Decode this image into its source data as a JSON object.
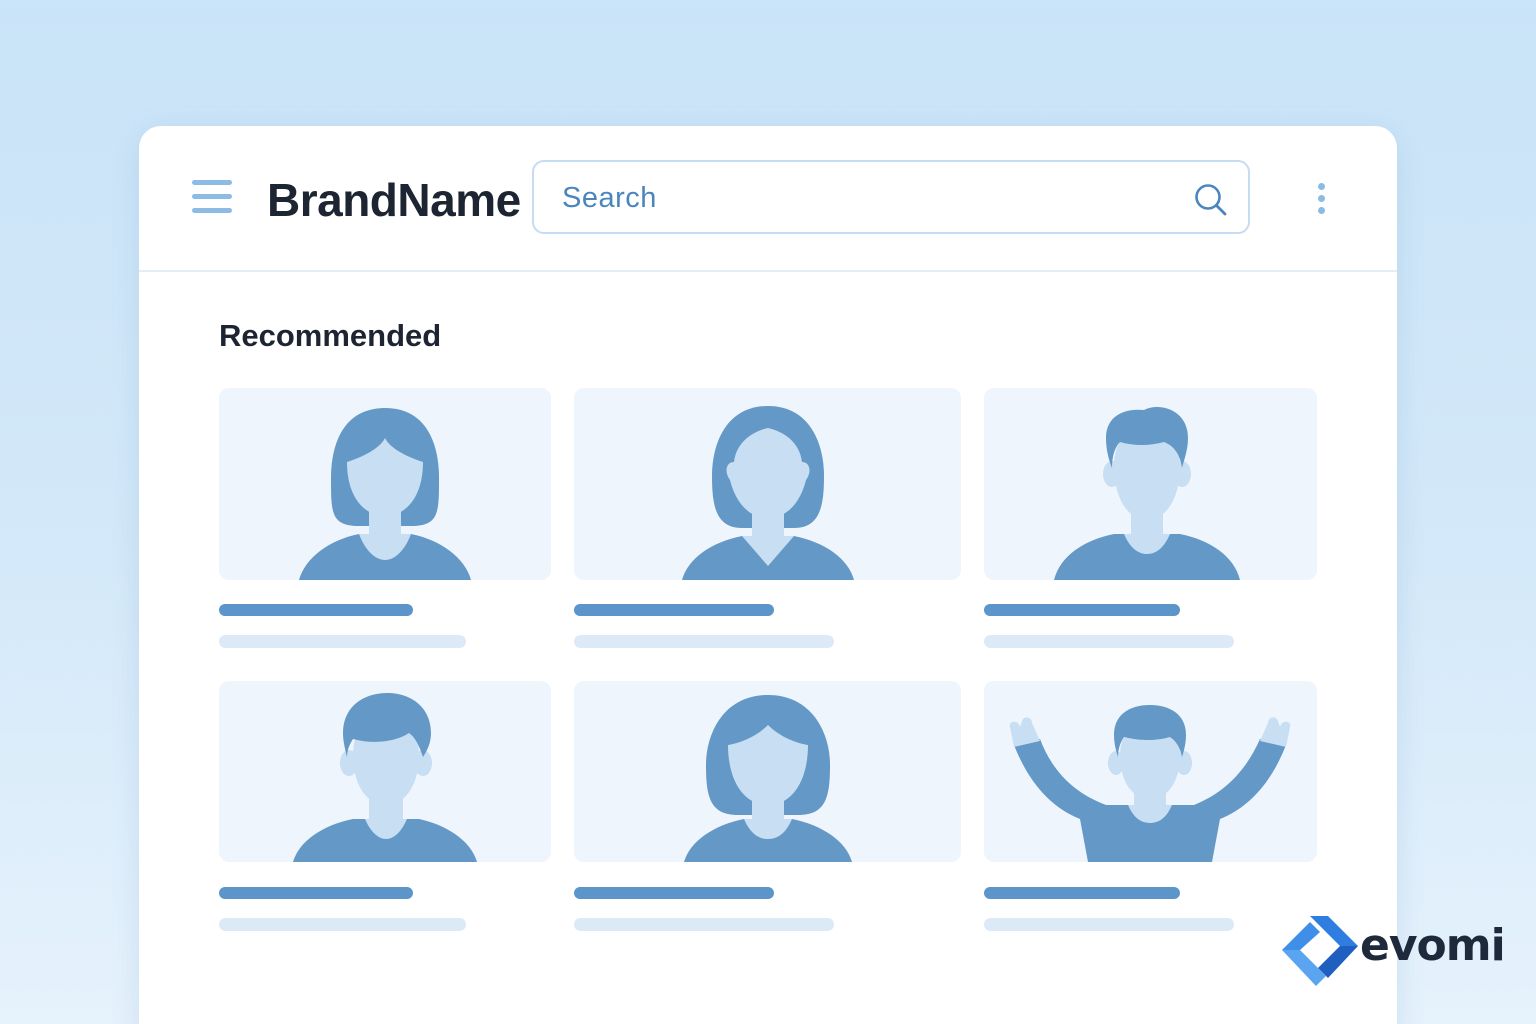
{
  "header": {
    "brand": "BrandName",
    "search_placeholder": "Search",
    "menu_icon": "hamburger-menu-icon",
    "search_icon": "magnifier-icon",
    "more_icon": "vertical-ellipsis-icon"
  },
  "main": {
    "section_title": "Recommended",
    "cards": [
      {
        "avatar": "woman-bob-avatar"
      },
      {
        "avatar": "woman-vneck-avatar"
      },
      {
        "avatar": "man-short-hair-avatar"
      },
      {
        "avatar": "man-side-part-avatar"
      },
      {
        "avatar": "woman-short-hair-avatar"
      },
      {
        "avatar": "man-arms-raised-avatar"
      }
    ]
  },
  "watermark": {
    "logo_text": "evomi"
  },
  "colors": {
    "accent": "#6398c7",
    "avatar_skin": "#c7def3",
    "card_background": "#eef5fc",
    "page_background": "#c9e3f8",
    "text_dark": "#1d2533",
    "search_text": "#4a86bd"
  }
}
